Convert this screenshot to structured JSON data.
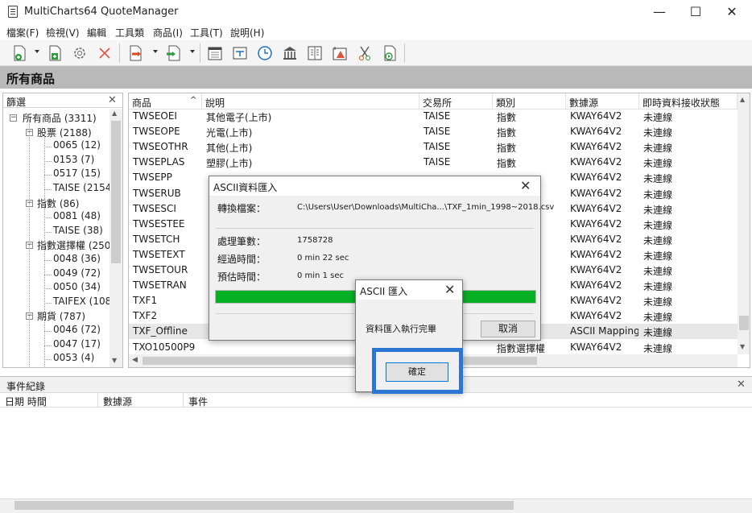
{
  "window": {
    "title": "MultiCharts64 QuoteManager",
    "controls": [
      "minimize",
      "maximize",
      "close"
    ]
  },
  "menu": [
    "檔案(F)",
    "檢視(V)",
    "編輯",
    "工具類",
    "商品(I)",
    "工具(T)",
    "說明(H)"
  ],
  "toolbar": {
    "icons": [
      "new-symbol-icon",
      "add-symbol-icon",
      "settings-gear-icon",
      "delete-icon",
      "import-data-icon",
      "export-data-icon",
      "calendar-icon",
      "session-icon",
      "clock-icon",
      "exchange-icon",
      "book-icon",
      "alert-icon",
      "cut-icon",
      "play-icon"
    ]
  },
  "section": {
    "title": "所有商品"
  },
  "filter": {
    "title": "篩選",
    "tree": [
      {
        "label": "所有商品 (3311)",
        "level": 0,
        "expander": "⊟"
      },
      {
        "label": "股票 (2188)",
        "level": 1,
        "expander": "⊟"
      },
      {
        "label": "0065 (12)",
        "level": 2
      },
      {
        "label": "0153 (7)",
        "level": 2
      },
      {
        "label": "0517 (15)",
        "level": 2
      },
      {
        "label": "TAISE (2154)",
        "level": 2
      },
      {
        "label": "指數 (86)",
        "level": 1,
        "expander": "⊟"
      },
      {
        "label": "0081 (48)",
        "level": 2
      },
      {
        "label": "TAISE (38)",
        "level": 2
      },
      {
        "label": "指數選擇權 (250",
        "level": 1,
        "expander": "⊟"
      },
      {
        "label": "0048 (36)",
        "level": 2
      },
      {
        "label": "0049 (72)",
        "level": 2
      },
      {
        "label": "0050 (34)",
        "level": 2
      },
      {
        "label": "TAIFEX (108)",
        "level": 2
      },
      {
        "label": "期貨 (787)",
        "level": 1,
        "expander": "⊟"
      },
      {
        "label": "0046 (72)",
        "level": 2
      },
      {
        "label": "0047 (17)",
        "level": 2
      },
      {
        "label": "0053 (4)",
        "level": 2
      }
    ]
  },
  "grid": {
    "columns": [
      "商品",
      "說明",
      "交易所",
      "類別",
      "數據源",
      "即時資料接收狀態"
    ],
    "rows": [
      [
        "TWSEOEI",
        "其他電子(上市)",
        "TAISE",
        "指數",
        "KWAY64V2",
        "未連線"
      ],
      [
        "TWSEOPE",
        "光電(上市)",
        "TAISE",
        "指數",
        "KWAY64V2",
        "未連線"
      ],
      [
        "TWSEOTHR",
        "其他(上市)",
        "TAISE",
        "指數",
        "KWAY64V2",
        "未連線"
      ],
      [
        "TWSEPLAS",
        "塑膠(上市)",
        "TAISE",
        "指數",
        "KWAY64V2",
        "未連線"
      ],
      [
        "TWSEPP",
        "",
        "",
        "",
        "KWAY64V2",
        "未連線"
      ],
      [
        "TWSERUB",
        "",
        "",
        "",
        "KWAY64V2",
        "未連線"
      ],
      [
        "TWSESCI",
        "",
        "",
        "",
        "KWAY64V2",
        "未連線"
      ],
      [
        "TWSESTEE",
        "",
        "",
        "",
        "KWAY64V2",
        "未連線"
      ],
      [
        "TWSETCH",
        "",
        "",
        "",
        "KWAY64V2",
        "未連線"
      ],
      [
        "TWSETEXT",
        "",
        "",
        "",
        "KWAY64V2",
        "未連線"
      ],
      [
        "TWSETOUR",
        "",
        "",
        "",
        "KWAY64V2",
        "未連線"
      ],
      [
        "TWSETRAN",
        "",
        "",
        "",
        "KWAY64V2",
        "未連線"
      ],
      [
        "TXF1",
        "",
        "",
        "",
        "KWAY64V2",
        "未連線"
      ],
      [
        "TXF2",
        "",
        "",
        "",
        "KWAY64V2",
        "未連線"
      ],
      [
        "TXF_Offline",
        "",
        "",
        "",
        "ASCII Mapping",
        "未連線"
      ],
      [
        "TXO10500P9",
        "",
        "",
        "指數選擇權",
        "KWAY64V2",
        "未連線"
      ]
    ]
  },
  "event_log": {
    "title": "事件紀錄",
    "columns": [
      "日期 時間",
      "數據源",
      "事件"
    ]
  },
  "import_dialog": {
    "title": "ASCII資料匯入",
    "file_label": "轉換檔案：",
    "file_value": "C:\\Users\\User\\Downloads\\MultiCha...\\TXF_1min_1998~2018.csv",
    "count_label": "處理筆數：",
    "count_value": "1758728",
    "elapsed_label": "經過時間：",
    "elapsed_value": "0 min 22 sec",
    "remaining_label": "預估時間：",
    "remaining_value": "0 min 1 sec",
    "progress": 1.0,
    "progress_color": "#06b025",
    "cancel_label": "取消"
  },
  "done_dialog": {
    "title": "ASCII 匯入",
    "message": "資料匯入執行完畢",
    "ok_label": "確定",
    "highlight_color": "#2a76d2"
  }
}
